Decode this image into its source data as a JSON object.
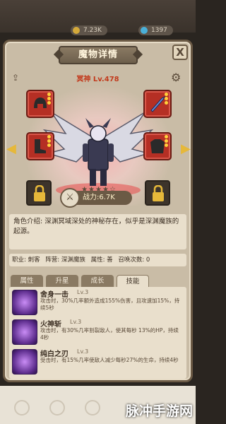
{
  "top": {
    "resource_1": "7.23K",
    "resource_2": "1397"
  },
  "panel": {
    "title": "魔物详情",
    "close_label": "X",
    "monster_name": "冥神 Lv.478",
    "power": "战力:6.7K"
  },
  "description": "角色介绍: 深渊冥域深处的神秘存在，似乎是深渊魔族的起源。",
  "info": {
    "job": "职业: 刺客",
    "camp": "阵营: 深渊魔族",
    "attribute": "属性: 善",
    "summon": "召唤次数: 0"
  },
  "tabs": [
    "属性",
    "升星",
    "成长",
    "技能"
  ],
  "skills": [
    {
      "name": "舍身一击",
      "level": "Lv.3",
      "desc": "攻击时，30%几率额外造成155%伤害，且攻速加15%，持续5秒"
    },
    {
      "name": "火神斩",
      "level": "Lv.3",
      "desc": "攻击时，有30%几率割裂敌人，使其每秒 13%的HP，持续4秒"
    },
    {
      "name": "纯白之刃",
      "level": "Lv.3",
      "desc": "受击时，有15%几率使敌人减少每秒27%的生命，持续4秒"
    }
  ],
  "watermark": "脉冲手游网",
  "colors": {
    "panel_bg": "#c9bca6",
    "equip_red": "#b52f24",
    "name_red": "#c23a1c",
    "gold": "#e6b83a"
  }
}
